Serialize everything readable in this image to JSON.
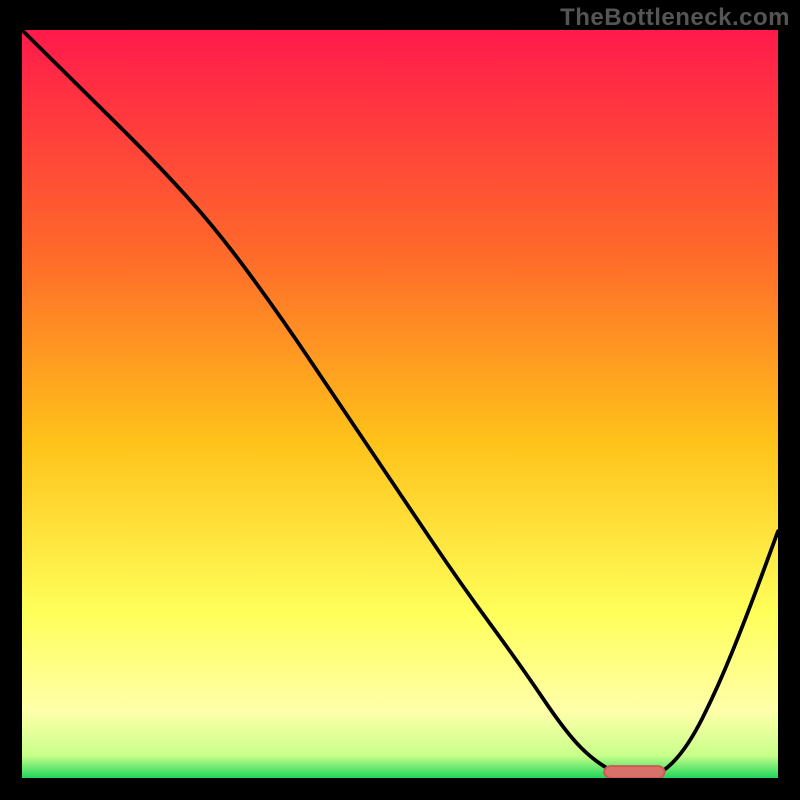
{
  "attribution": "TheBottleneck.com",
  "colors": {
    "frame": "#000000",
    "attribution_text": "#555555",
    "gradient_top": "#ff1a4b",
    "gradient_mid1": "#ff8a1f",
    "gradient_mid2": "#ffe11a",
    "gradient_mid3": "#ffff8a",
    "gradient_bot": "#1fd65b",
    "curve": "#000000",
    "marker_fill": "#d9716b",
    "marker_stroke": "#c95a54"
  },
  "chart_data": {
    "type": "line",
    "title": "",
    "xlabel": "",
    "ylabel": "",
    "xlim": [
      0,
      100
    ],
    "ylim": [
      0,
      100
    ],
    "series": [
      {
        "name": "bottleneck-curve",
        "x": [
          0,
          8,
          18,
          26,
          34,
          42,
          50,
          58,
          66,
          72,
          76,
          80,
          84,
          88,
          92,
          96,
          100
        ],
        "y": [
          100,
          92,
          82,
          73,
          62,
          50,
          38,
          26,
          15,
          6,
          2,
          0,
          0,
          4,
          12,
          22,
          33
        ]
      }
    ],
    "marker": {
      "name": "optimal-range",
      "x_start": 77,
      "x_end": 85,
      "y": 0.8
    },
    "gradient_stops": [
      {
        "offset": 0.0,
        "color": "#ff1a4b"
      },
      {
        "offset": 0.3,
        "color": "#ff6a2a"
      },
      {
        "offset": 0.55,
        "color": "#ffc21a"
      },
      {
        "offset": 0.78,
        "color": "#ffff5a"
      },
      {
        "offset": 0.91,
        "color": "#ffffaa"
      },
      {
        "offset": 0.97,
        "color": "#c8ff8a"
      },
      {
        "offset": 1.0,
        "color": "#1fd65b"
      }
    ]
  }
}
